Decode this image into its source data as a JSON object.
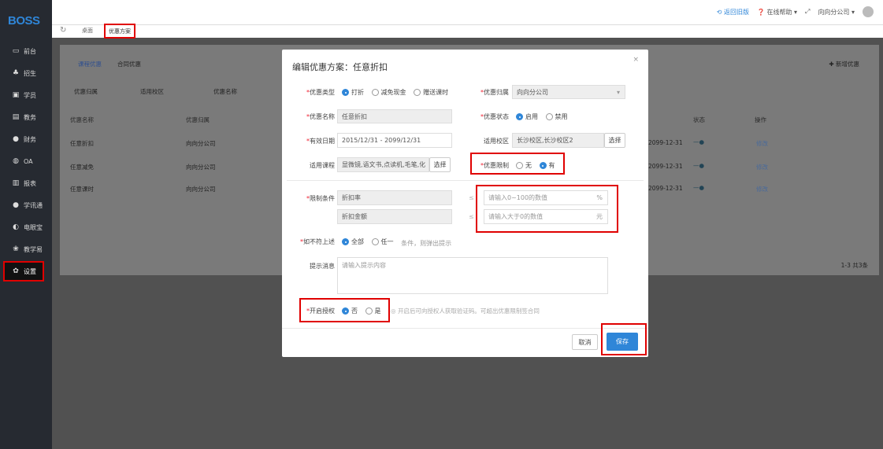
{
  "logo": "BOSS",
  "sidebar": {
    "items": [
      {
        "label": "前台",
        "icon": "calendar-icon"
      },
      {
        "label": "招生",
        "icon": "users-icon"
      },
      {
        "label": "学员",
        "icon": "student-icon"
      },
      {
        "label": "教务",
        "icon": "book-icon"
      },
      {
        "label": "财务",
        "icon": "finance-icon"
      },
      {
        "label": "OA",
        "icon": "oa-icon"
      },
      {
        "label": "报表",
        "icon": "chart-icon"
      },
      {
        "label": "学讯通",
        "icon": "message-icon"
      },
      {
        "label": "电眼宝",
        "icon": "camera-icon"
      },
      {
        "label": "教学易",
        "icon": "teach-icon"
      },
      {
        "label": "设置",
        "icon": "gear-icon"
      }
    ]
  },
  "topbar": {
    "back": "返回旧版",
    "help": "在线帮助",
    "company": "向向分公司"
  },
  "tabs": {
    "home": "桌面",
    "active": "优惠方案"
  },
  "page": {
    "tab1": "课程优惠",
    "tab2": "合同优惠",
    "add": "新增优惠",
    "filter1": "优惠归属",
    "filter2": "适用校区",
    "filter3": "优惠名称",
    "headers": [
      "优惠名称",
      "优惠归属",
      "状态",
      "操作"
    ],
    "rows": [
      {
        "name": "任意折扣",
        "owner": "向向分公司",
        "date": "2099-12-31",
        "action": "修改"
      },
      {
        "name": "任意减免",
        "owner": "向向分公司",
        "date": "2099-12-31",
        "action": "修改"
      },
      {
        "name": "任意课时",
        "owner": "向向分公司",
        "date": "2099-12-31",
        "action": "修改"
      }
    ],
    "pager": "1-3 共3条"
  },
  "modal": {
    "title": "编辑优惠方案：任意折扣",
    "type_label": "优惠类型",
    "type_opts": [
      "打折",
      "减免现金",
      "赠送课时"
    ],
    "owner_label": "优惠归属",
    "owner_value": "向向分公司",
    "name_label": "优惠名称",
    "name_value": "任意折扣",
    "status_label": "优惠状态",
    "status_opts": [
      "启用",
      "禁用"
    ],
    "date_label": "有效日期",
    "date_value": "2015/12/31 - 2099/12/31",
    "campus_label": "适用校区",
    "campus_value": "长沙校区,长沙校区2",
    "choose": "选择",
    "course_label": "适用课程",
    "course_value": "显微镜,语文书,点读机,毛笔,化",
    "limit_label": "优惠限制",
    "limit_opts": [
      "无",
      "有"
    ],
    "cond_label": "限制条件",
    "cond1": "折扣率",
    "cond2": "折扣金额",
    "cond1_ph": "请输入0~100的数值",
    "cond1_unit": "%",
    "cond2_ph": "请输入大于0的数值",
    "cond2_unit": "元",
    "notmet_label": "如不符上述",
    "notmet_opts": [
      "全部",
      "任一"
    ],
    "notmet_tail": "条件，则弹出提示",
    "tip_label": "提示消息",
    "tip_ph": "请输入提示内容",
    "auth_label": "开启授权",
    "auth_opts": [
      "否",
      "是"
    ],
    "auth_hint": "开启后可向授权人获取验证码。可超出优惠限制签合同",
    "cancel": "取消",
    "save": "保存"
  }
}
